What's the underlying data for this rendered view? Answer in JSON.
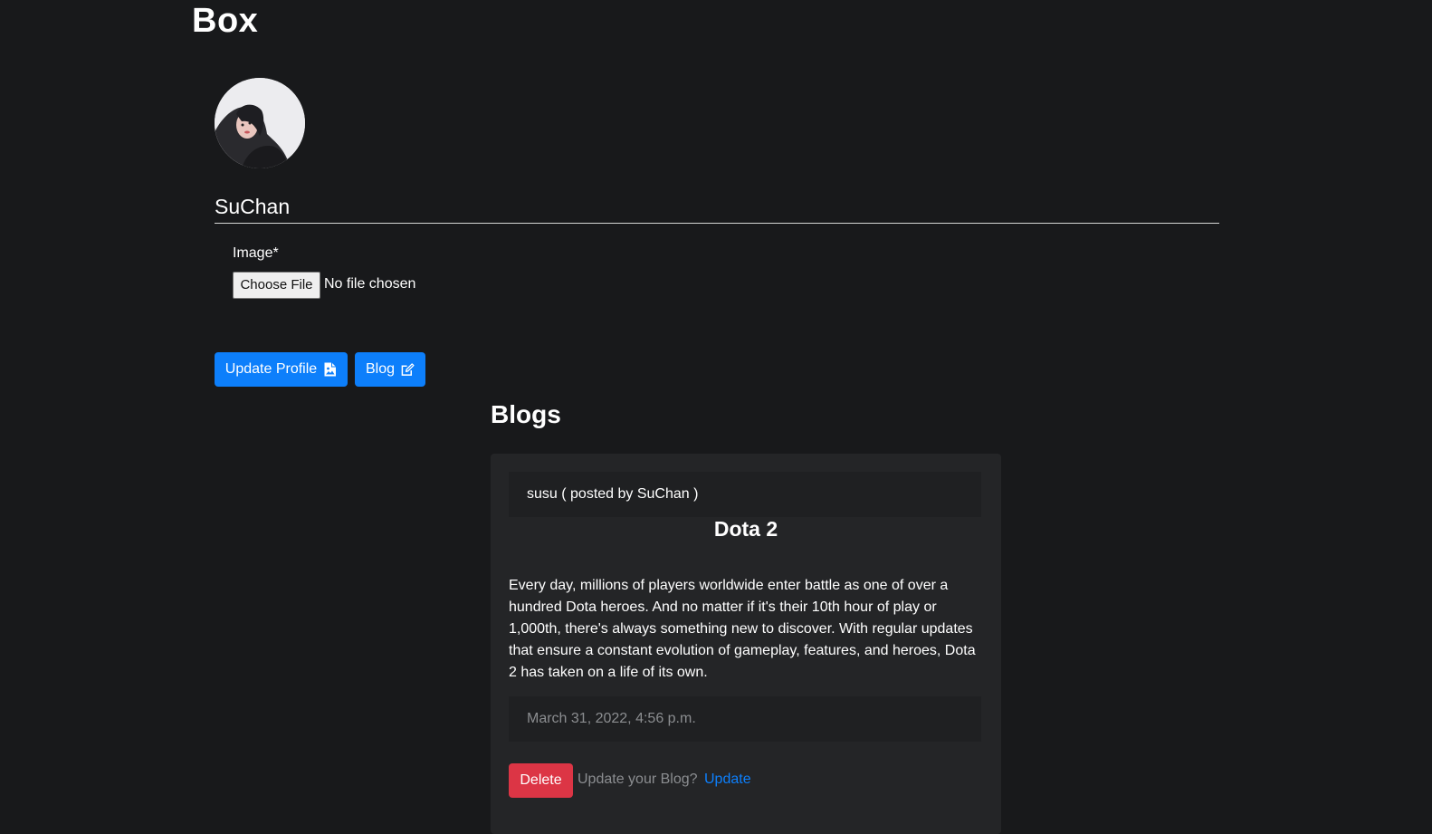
{
  "brand": "Box",
  "profile": {
    "avatar_alt": "profile photo",
    "username": "SuChan",
    "image_field": {
      "label": "Image*",
      "button_label": "Choose File",
      "status": "No file chosen"
    },
    "actions": {
      "update_label": "Update Profile",
      "update_icon": "file-image-icon",
      "blog_label": "Blog",
      "blog_icon": "edit-icon"
    }
  },
  "blogs": {
    "heading": "Blogs",
    "posts": [
      {
        "header": "susu ( posted by SuChan )",
        "title": "Dota 2",
        "body": "Every day, millions of players worldwide enter battle as one of over a hundred Dota heroes. And no matter if it's their 10th hour of play or 1,000th, there's always something new to discover. With regular updates that ensure a constant evolution of gameplay, features, and heroes, Dota 2 has taken on a life of its own.",
        "date": "March 31, 2022, 4:56 p.m.",
        "delete_label": "Delete",
        "update_prompt": "Update your Blog?",
        "update_link": "Update"
      }
    ]
  },
  "colors": {
    "background": "#18191b",
    "card": "#242527",
    "primary": "#0d7ffb",
    "danger": "#dc3545",
    "muted": "#8b8d90"
  }
}
